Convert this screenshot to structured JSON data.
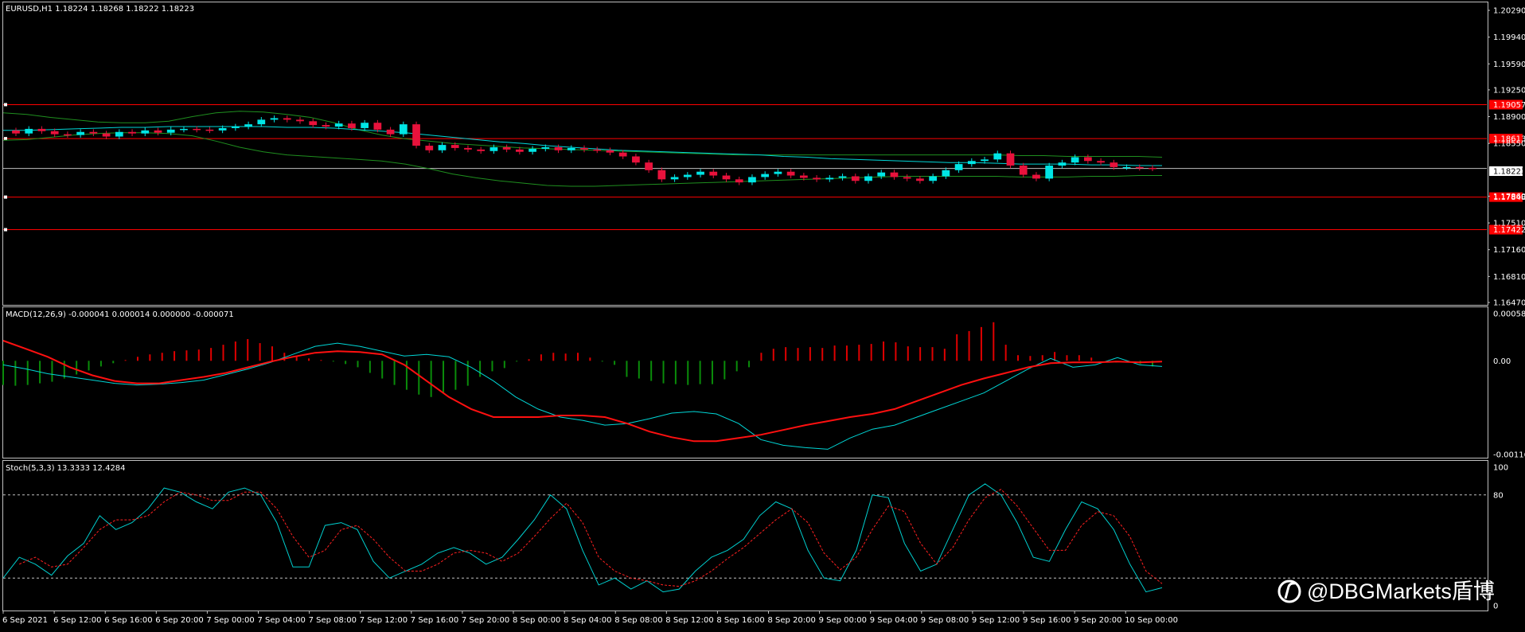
{
  "window": {
    "main_title": "EURUSD,H1  1.18224 1.18268 1.18222 1.18223",
    "macd_title": "MACD(12,26,9) -0.000041 0.000014 0.000000 -0.000071",
    "stoch_title": "Stoch(5,3,3) 13.3333 12.4284",
    "watermark": "@DBGMarkets盾博",
    "current_price_label": "1.18223"
  },
  "colors": {
    "background": "#000000",
    "frame": "#c0c0c0",
    "bull": "#00e5e5",
    "bear": "#e8123c",
    "level": "#ff0000",
    "ma": "#00d6d6",
    "band": "#1f8f1f",
    "macd_pos": "#e00000",
    "macd_neg": "#0a8c0a",
    "signal": "#ff1010",
    "stoch_main": "#00d0d0",
    "stoch_signal": "#ff2020",
    "text": "#ffffff"
  },
  "chart_data": [
    {
      "type": "candlestick",
      "symbol": "EURUSD",
      "timeframe": "H1",
      "ylim": [
        1.1647,
        1.2029
      ],
      "y_ticks": [
        "1.20290",
        "1.19940",
        "1.19590",
        "1.19250",
        "1.18900",
        "1.18550",
        "1.17860",
        "1.17510",
        "1.17160",
        "1.16810",
        "1.16470"
      ],
      "current_price": 1.18223,
      "levels": [
        {
          "value": 1.19057,
          "label": "1.19057"
        },
        {
          "value": 1.18613,
          "label": "1.18613"
        },
        {
          "value": 1.17848,
          "label": "1.17848"
        },
        {
          "value": 1.17422,
          "label": "1.17422"
        }
      ],
      "x_labels": [
        "6 Sep 2021",
        "6 Sep 12:00",
        "6 Sep 16:00",
        "6 Sep 20:00",
        "7 Sep 00:00",
        "7 Sep 04:00",
        "7 Sep 08:00",
        "7 Sep 12:00",
        "7 Sep 16:00",
        "7 Sep 20:00",
        "8 Sep 00:00",
        "8 Sep 04:00",
        "8 Sep 08:00",
        "8 Sep 12:00",
        "8 Sep 16:00",
        "8 Sep 20:00",
        "9 Sep 00:00",
        "9 Sep 04:00",
        "9 Sep 08:00",
        "9 Sep 12:00",
        "9 Sep 16:00",
        "9 Sep 20:00",
        "10 Sep 00:00"
      ],
      "closes": [
        1.1868,
        1.1874,
        1.1871,
        1.1867,
        1.1866,
        1.187,
        1.1868,
        1.1864,
        1.187,
        1.1868,
        1.1872,
        1.1869,
        1.1873,
        1.1874,
        1.1873,
        1.1872,
        1.1875,
        1.1877,
        1.188,
        1.1886,
        1.1888,
        1.1886,
        1.1884,
        1.1879,
        1.1877,
        1.1881,
        1.1875,
        1.1882,
        1.1873,
        1.1867,
        1.188,
        1.1852,
        1.1846,
        1.1853,
        1.1849,
        1.1847,
        1.1845,
        1.185,
        1.1847,
        1.1844,
        1.1848,
        1.185,
        1.1846,
        1.1849,
        1.1847,
        1.1846,
        1.1843,
        1.1838,
        1.183,
        1.182,
        1.1808,
        1.1811,
        1.1814,
        1.1818,
        1.1813,
        1.1808,
        1.1804,
        1.1811,
        1.1815,
        1.1818,
        1.1813,
        1.181,
        1.1808,
        1.181,
        1.1812,
        1.1806,
        1.1812,
        1.1817,
        1.1811,
        1.1809,
        1.1806,
        1.1812,
        1.182,
        1.1828,
        1.1832,
        1.1834,
        1.1842,
        1.1826,
        1.1814,
        1.1809,
        1.1826,
        1.183,
        1.1837,
        1.1832,
        1.183,
        1.1824,
        1.1824,
        1.1823,
        1.18223
      ],
      "ma": [
        1.1872,
        1.1872,
        1.1873,
        1.1874,
        1.1875,
        1.1876,
        1.1876,
        1.1877,
        1.1877,
        1.1877,
        1.1877,
        1.1877,
        1.1876,
        1.1876,
        1.1875,
        1.1873,
        1.1871,
        1.1869,
        1.1866,
        1.1863,
        1.186,
        1.1857,
        1.1855,
        1.1852,
        1.185,
        1.1848,
        1.1846,
        1.1845,
        1.1844,
        1.1843,
        1.1842,
        1.1841,
        1.184,
        1.1838,
        1.1837,
        1.1835,
        1.1834,
        1.1833,
        1.1832,
        1.1831,
        1.183,
        1.183,
        1.1829,
        1.1828,
        1.1828,
        1.1828,
        1.1827,
        1.1827,
        1.1826,
        1.1826
      ],
      "band_upper": [
        1.1895,
        1.1893,
        1.1889,
        1.1886,
        1.1883,
        1.1882,
        1.1882,
        1.1884,
        1.189,
        1.1895,
        1.1897,
        1.1896,
        1.1893,
        1.1889,
        1.1882,
        1.1873,
        1.1866,
        1.1861,
        1.1858,
        1.1855,
        1.1853,
        1.1851,
        1.1849,
        1.1848,
        1.1847,
        1.1846,
        1.1845,
        1.1844,
        1.1843,
        1.1842,
        1.1841,
        1.184,
        1.184,
        1.184,
        1.184,
        1.184,
        1.184,
        1.184,
        1.184,
        1.184,
        1.184,
        1.184,
        1.184,
        1.1839,
        1.1839,
        1.1838,
        1.1838,
        1.1838,
        1.1838,
        1.1837
      ],
      "band_lower": [
        1.1859,
        1.186,
        1.1863,
        1.1866,
        1.1868,
        1.1869,
        1.1869,
        1.1868,
        1.1865,
        1.1858,
        1.185,
        1.1844,
        1.184,
        1.1838,
        1.1836,
        1.1834,
        1.1832,
        1.1828,
        1.1822,
        1.1815,
        1.181,
        1.1806,
        1.1803,
        1.18,
        1.1799,
        1.1799,
        1.18,
        1.1801,
        1.1802,
        1.1803,
        1.1804,
        1.1805,
        1.1806,
        1.1807,
        1.1808,
        1.1809,
        1.181,
        1.1811,
        1.1812,
        1.1812,
        1.1812,
        1.1812,
        1.1812,
        1.1811,
        1.1811,
        1.1811,
        1.1812,
        1.1812,
        1.1813,
        1.1813
      ]
    },
    {
      "type": "macd",
      "title": "MACD(12,26,9)",
      "ylim": [
        -0.001165,
        0.000587
      ],
      "y_ticks": [
        "0.000587",
        "0.00",
        "-0.001165"
      ],
      "histogram": [
        -0.0003,
        -0.00031,
        -0.0003,
        -0.00028,
        -0.00026,
        -0.00022,
        -0.00017,
        -0.00012,
        -7e-05,
        -3e-05,
        1e-05,
        5e-05,
        8e-05,
        0.0001,
        0.00012,
        0.00013,
        0.00014,
        0.00016,
        0.0002,
        0.00024,
        0.00027,
        0.00022,
        0.00018,
        0.0001,
        6e-05,
        3e-05,
        1e-05,
        -1e-05,
        -4e-05,
        -8e-05,
        -0.00015,
        -0.00022,
        -0.0003,
        -0.00036,
        -0.00042,
        -0.00045,
        -0.0004,
        -0.00036,
        -0.00031,
        -0.0002,
        -0.00013,
        -9e-05,
        -1e-05,
        2e-05,
        8e-05,
        0.0001,
        9e-05,
        0.0001,
        4e-05,
        -1e-05,
        -5e-05,
        -0.0002,
        -0.00022,
        -0.00025,
        -0.00028,
        -0.00029,
        -0.0003,
        -0.00029,
        -0.00029,
        -0.00023,
        -0.00013,
        -8e-05,
        0.0001,
        0.00015,
        0.00017,
        0.00016,
        0.00017,
        0.00016,
        0.00019,
        0.00019,
        0.0002,
        0.00021,
        0.00024,
        0.00023,
        0.00018,
        0.00017,
        0.00017,
        0.00015,
        0.00033,
        0.00037,
        0.00042,
        0.00048,
        0.0002,
        7e-05,
        6e-05,
        7e-05,
        0.00011,
        7e-05,
        7e-05,
        4e-05,
        0.0,
        -2e-05,
        -2e-05,
        -4e-05,
        -7e-05
      ],
      "macd_line": [
        -5e-05,
        -0.0001,
        -0.00016,
        -0.0002,
        -0.00024,
        -0.00028,
        -0.0003,
        -0.00029,
        -0.00027,
        -0.00024,
        -0.00017,
        -0.0001,
        -2e-05,
        8e-05,
        0.00018,
        0.00022,
        0.00018,
        0.00012,
        6e-05,
        8e-05,
        5e-05,
        -8e-05,
        -0.00025,
        -0.00045,
        -0.0006,
        -0.0007,
        -0.00074,
        -0.0008,
        -0.00078,
        -0.00072,
        -0.00065,
        -0.00063,
        -0.00066,
        -0.00078,
        -0.00098,
        -0.00105,
        -0.00108,
        -0.0011,
        -0.00096,
        -0.00085,
        -0.0008,
        -0.0007,
        -0.0006,
        -0.0005,
        -0.0004,
        -0.00025,
        -0.0001,
        3e-05,
        -8e-05,
        -5e-05,
        4e-05,
        -5e-05,
        -7e-05
      ],
      "signal_line": [
        0.00025,
        0.00015,
        5e-05,
        -8e-05,
        -0.00018,
        -0.00025,
        -0.00028,
        -0.00028,
        -0.00024,
        -0.0002,
        -0.00015,
        -8e-05,
        -1e-05,
        5e-05,
        0.0001,
        0.00012,
        0.00011,
        8e-05,
        -5e-05,
        -0.00025,
        -0.00045,
        -0.0006,
        -0.0007,
        -0.0007,
        -0.0007,
        -0.00068,
        -0.00068,
        -0.0007,
        -0.00078,
        -0.00088,
        -0.00095,
        -0.001,
        -0.001,
        -0.00096,
        -0.00092,
        -0.00086,
        -0.0008,
        -0.00075,
        -0.0007,
        -0.00066,
        -0.0006,
        -0.0005,
        -0.0004,
        -0.0003,
        -0.00022,
        -0.00015,
        -8e-05,
        -3e-05,
        -2e-05,
        -2e-05,
        -1e-05,
        -2e-05,
        -1e-05
      ]
    },
    {
      "type": "line",
      "title": "Stoch(5,3,3)",
      "ylim": [
        0,
        100
      ],
      "y_ticks": [
        "100",
        "80",
        "0"
      ],
      "levels": [
        80,
        20
      ],
      "main_line": [
        20,
        35,
        30,
        22,
        36,
        45,
        65,
        55,
        60,
        70,
        85,
        82,
        75,
        70,
        82,
        85,
        80,
        60,
        28,
        28,
        58,
        60,
        55,
        32,
        20,
        25,
        30,
        38,
        42,
        38,
        30,
        35,
        48,
        62,
        80,
        70,
        40,
        15,
        20,
        12,
        18,
        10,
        12,
        25,
        35,
        40,
        48,
        65,
        75,
        70,
        40,
        20,
        18,
        40,
        80,
        78,
        45,
        25,
        30,
        55,
        80,
        88,
        80,
        60,
        35,
        32,
        55,
        75,
        70,
        55,
        30,
        10,
        13
      ],
      "signal_line": [
        null,
        30,
        35,
        28,
        30,
        42,
        55,
        62,
        62,
        65,
        75,
        82,
        80,
        76,
        76,
        82,
        82,
        70,
        50,
        35,
        40,
        55,
        58,
        48,
        35,
        25,
        25,
        30,
        38,
        40,
        38,
        32,
        38,
        50,
        63,
        74,
        60,
        35,
        25,
        20,
        18,
        15,
        14,
        18,
        25,
        34,
        42,
        52,
        62,
        70,
        60,
        38,
        26,
        35,
        55,
        72,
        68,
        45,
        30,
        42,
        62,
        78,
        84,
        72,
        56,
        40,
        40,
        58,
        68,
        65,
        50,
        25,
        16
      ]
    }
  ]
}
